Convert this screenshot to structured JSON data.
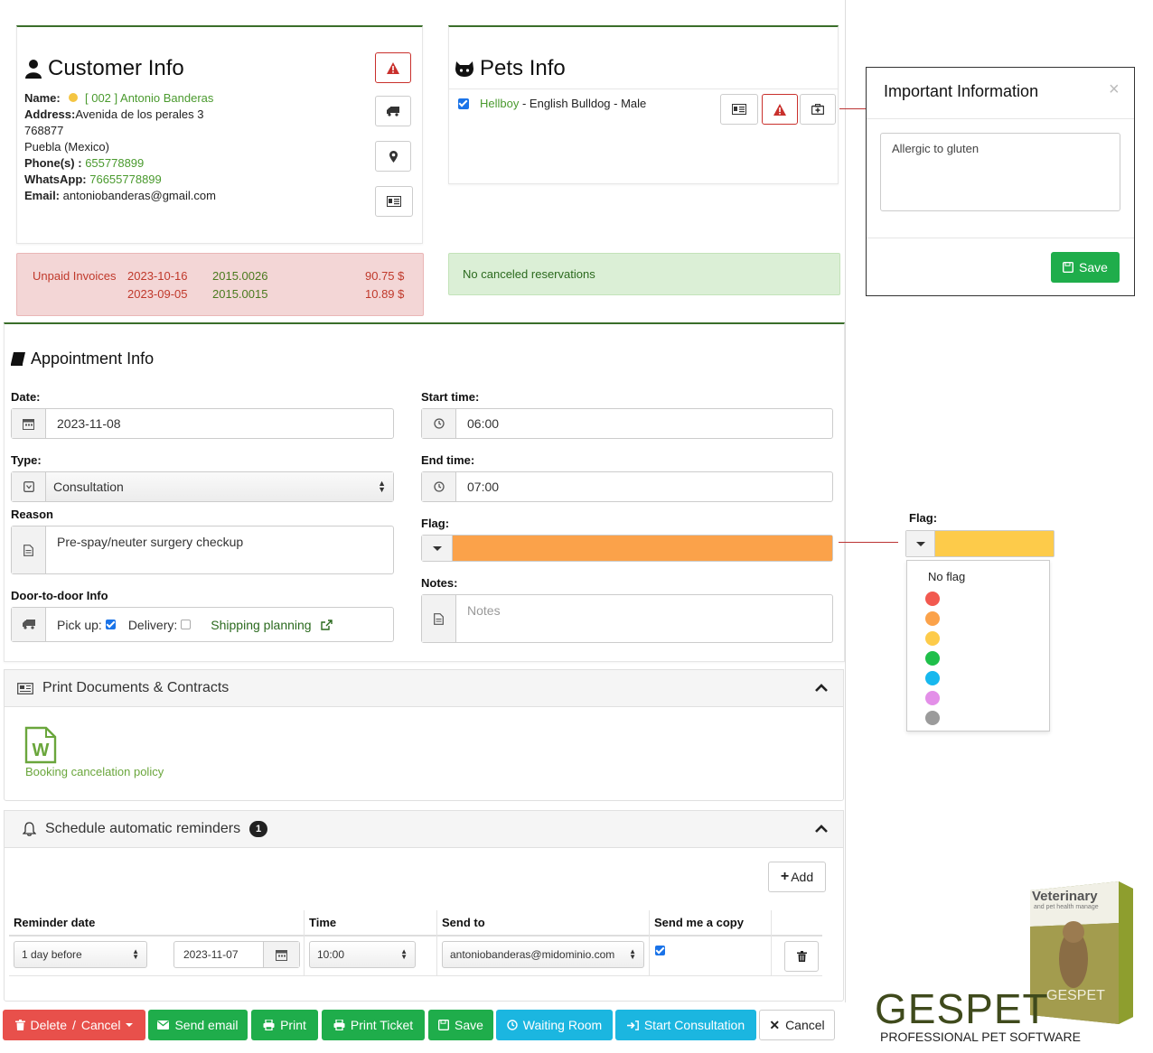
{
  "customer": {
    "title": "Customer Info",
    "name_label": "Name:",
    "name_value": "[ 002 ] Antonio Banderas",
    "address_label": "Address:",
    "address_line1": "Avenida de los perales 3",
    "address_line2": "768877",
    "address_line3": "Puebla (Mexico)",
    "phone_label": "Phone(s) :",
    "phone_value": "655778899",
    "whatsapp_label": "WhatsApp:",
    "whatsapp_value": "76655778899",
    "email_label": "Email:",
    "email_value": "antoniobanderas@gmail.com"
  },
  "invoices": {
    "label": "Unpaid Invoices",
    "rows": [
      {
        "date": "2023-10-16",
        "number": "2015.0026",
        "amount": "90.75 $"
      },
      {
        "date": "2023-09-05",
        "number": "2015.0015",
        "amount": "10.89 $"
      }
    ]
  },
  "pets": {
    "title": "Pets Info",
    "pet_name": "Hellboy",
    "pet_details": " - English Bulldog - Male",
    "reservations_text": "No canceled reservations"
  },
  "important": {
    "title": "Important Information",
    "close": "×",
    "text": "Allergic to gluten",
    "save_label": "Save"
  },
  "appointment": {
    "title": "Appointment Info",
    "date_label": "Date:",
    "date_value": "2023-11-08",
    "start_label": "Start time:",
    "start_value": "06:00",
    "type_label": "Type:",
    "type_value": "Consultation",
    "end_label": "End time:",
    "end_value": "07:00",
    "reason_label": "Reason",
    "reason_value": "Pre-spay/neuter surgery checkup",
    "flag_label": "Flag:",
    "flag_color": "#fba24a",
    "door_label": "Door-to-door Info",
    "pickup_label": "Pick up:",
    "delivery_label": "Delivery:",
    "shipping_label": "Shipping planning",
    "notes_label": "Notes:",
    "notes_placeholder": "Notes"
  },
  "flag_popup": {
    "label": "Flag:",
    "selected_color": "#fdcb4a",
    "no_flag": "No flag",
    "colors": [
      "#f2594f",
      "#fba24a",
      "#fdcb4a",
      "#1fbf4a",
      "#17b8ee",
      "#e38fe8",
      "#9b9b9b"
    ]
  },
  "print_docs": {
    "title": "Print Documents & Contracts",
    "doc_label": "Booking cancelation policy"
  },
  "reminders": {
    "title": "Schedule automatic reminders",
    "badge": "1",
    "add_label": "Add",
    "headers": [
      "Reminder date",
      "Time",
      "Send to",
      "Send me a copy"
    ],
    "row": {
      "before": "1 day before",
      "date": "2023-11-07",
      "time": "10:00",
      "email": "antoniobanderas@midominio.com"
    }
  },
  "buttons": {
    "delete": "Delete",
    "slash": "/",
    "cancel_drop": "Cancel",
    "send_email": "Send email",
    "print": "Print",
    "print_ticket": "Print Ticket",
    "save": "Save",
    "waiting_room": "Waiting Room",
    "start_consultation": "Start Consultation",
    "cancel": "Cancel"
  },
  "branding": {
    "box_title": "Veterinary",
    "box_subtitle": "and pet health manage",
    "box_brand": "GESPET",
    "logo": "GESPET",
    "tagline": "PROFESSIONAL PET SOFTWARE"
  }
}
